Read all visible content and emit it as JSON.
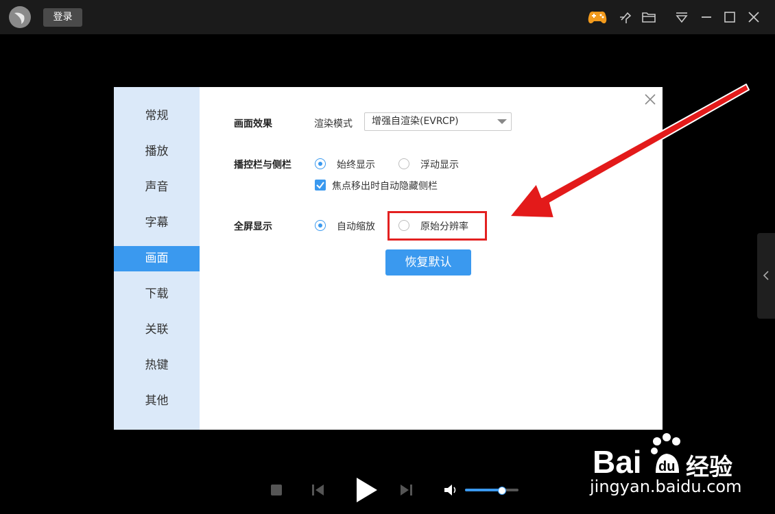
{
  "topbar": {
    "login_label": "登录"
  },
  "dialog": {
    "sidebar": [
      {
        "label": "常规"
      },
      {
        "label": "播放"
      },
      {
        "label": "声音"
      },
      {
        "label": "字幕"
      },
      {
        "label": "画面",
        "active": true
      },
      {
        "label": "下载"
      },
      {
        "label": "关联"
      },
      {
        "label": "热键"
      },
      {
        "label": "其他"
      }
    ],
    "picture_effect": {
      "label": "画面效果",
      "render_mode_label": "渲染模式",
      "render_mode_value": "增强自渲染(EVRCP)"
    },
    "control_bar": {
      "label": "播控栏与侧栏",
      "option_always": "始终显示",
      "option_float": "浮动显示",
      "selected": "始终显示",
      "auto_hide_label": "焦点移出时自动隐藏侧栏",
      "auto_hide_checked": true
    },
    "fullscreen": {
      "label": "全屏显示",
      "option_auto": "自动缩放",
      "option_original": "原始分辨率",
      "selected": "自动缩放"
    },
    "restore_button": "恢复默认"
  },
  "player": {
    "volume_level": 0.68
  },
  "watermark": {
    "brand": "Bai du 经验",
    "url": "jingyan.baidu.com"
  },
  "colors": {
    "accent": "#3a99ef",
    "sidebar_bg": "#dbe9f9",
    "highlight": "#e32020",
    "arrow": "#e31a1a"
  }
}
